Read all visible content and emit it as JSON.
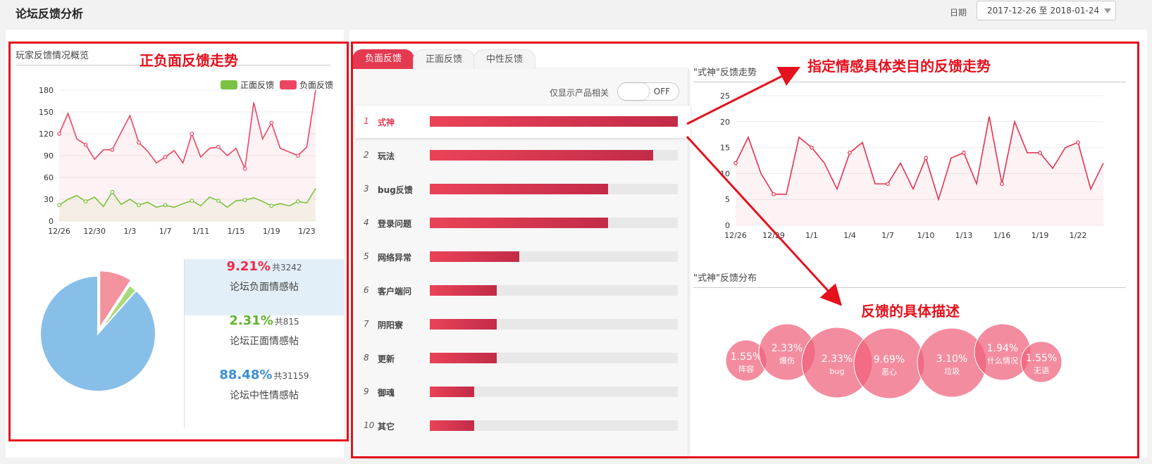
{
  "page": {
    "title": "论坛反馈分析",
    "date_label": "日期",
    "date_range": "2017-12-26 至 2018-01-24"
  },
  "annotations": {
    "left_box": "正负面反馈走势",
    "trend": "指定情感具体类目的反馈走势",
    "bubbles": "反馈的具体描述"
  },
  "overview": {
    "title": "玩家反馈情况概览",
    "legend": [
      {
        "name": "正面反馈",
        "color": "#7bc142"
      },
      {
        "name": "负面反馈",
        "color": "#ec4562"
      }
    ],
    "stats": [
      {
        "pct": "9.21%",
        "total": "共3242",
        "label": "论坛负面情感帖",
        "color": "#ec2a46"
      },
      {
        "pct": "2.31%",
        "total": "共815",
        "label": "论坛正面情感帖",
        "color": "#62b331"
      },
      {
        "pct": "88.48%",
        "total": "共31159",
        "label": "论坛中性情感帖",
        "color": "#3c8fd3"
      }
    ]
  },
  "tabs": [
    {
      "label": "负面反馈",
      "active": true
    },
    {
      "label": "正面反馈",
      "active": false
    },
    {
      "label": "中性反馈",
      "active": false
    }
  ],
  "filter": {
    "label": "仅显示产品相关",
    "toggle": "OFF"
  },
  "categories": [
    {
      "rank": "1",
      "name": "式神",
      "value": 100,
      "selected": true
    },
    {
      "rank": "2",
      "name": "玩法",
      "value": 90
    },
    {
      "rank": "3",
      "name": "bug反馈",
      "value": 72
    },
    {
      "rank": "4",
      "name": "登录问题",
      "value": 72
    },
    {
      "rank": "5",
      "name": "网络异常",
      "value": 36
    },
    {
      "rank": "6",
      "name": "客户端问",
      "value": 27
    },
    {
      "rank": "7",
      "name": "阴阳寮",
      "value": 27
    },
    {
      "rank": "8",
      "name": "更新",
      "value": 27
    },
    {
      "rank": "9",
      "name": "御魂",
      "value": 18
    },
    {
      "rank": "10",
      "name": "其它",
      "value": 18
    }
  ],
  "trend_title": "\"式神\"反馈走势",
  "dist_title": "\"式神\"反馈分布",
  "chart_data": [
    {
      "type": "line",
      "x": [
        "12/26",
        "12/27",
        "12/28",
        "12/29",
        "12/30",
        "12/31",
        "1/1",
        "1/2",
        "1/3",
        "1/4",
        "1/5",
        "1/6",
        "1/7",
        "1/8",
        "1/9",
        "1/10",
        "1/11",
        "1/12",
        "1/13",
        "1/14",
        "1/15",
        "1/16",
        "1/17",
        "1/18",
        "1/19",
        "1/20",
        "1/21",
        "1/22",
        "1/23",
        "1/24"
      ],
      "xticks": [
        "12/26",
        "12/30",
        "1/3",
        "1/7",
        "1/11",
        "1/15",
        "1/19",
        "1/23"
      ],
      "ylim": [
        0,
        180
      ],
      "yticks": [
        0,
        30,
        60,
        90,
        120,
        150,
        180
      ],
      "series": [
        {
          "name": "负面反馈",
          "color": "#ec4562",
          "values": [
            120,
            148,
            113,
            105,
            85,
            98,
            98,
            122,
            145,
            108,
            96,
            80,
            88,
            97,
            80,
            120,
            88,
            100,
            102,
            90,
            100,
            72,
            163,
            113,
            135,
            100,
            95,
            90,
            102,
            180
          ]
        },
        {
          "name": "正面反馈",
          "color": "#7bc142",
          "values": [
            22,
            30,
            35,
            27,
            33,
            20,
            40,
            23,
            30,
            22,
            26,
            19,
            22,
            19,
            24,
            28,
            21,
            33,
            28,
            19,
            28,
            29,
            32,
            27,
            21,
            24,
            21,
            27,
            25,
            45
          ]
        }
      ]
    },
    {
      "type": "pie",
      "slices": [
        {
          "label": "论坛负面情感帖",
          "value": 9.21,
          "color": "#f4929d"
        },
        {
          "label": "论坛正面情感帖",
          "value": 2.31,
          "color": "#a8da7a"
        },
        {
          "label": "论坛中性情感帖",
          "value": 88.48,
          "color": "#87bfe9"
        }
      ]
    },
    {
      "type": "line",
      "x": [
        "12/26",
        "12/27",
        "12/28",
        "12/29",
        "12/30",
        "12/31",
        "1/1",
        "1/2",
        "1/3",
        "1/4",
        "1/5",
        "1/6",
        "1/7",
        "1/8",
        "1/9",
        "1/10",
        "1/11",
        "1/12",
        "1/13",
        "1/14",
        "1/15",
        "1/16",
        "1/17",
        "1/18",
        "1/19",
        "1/20",
        "1/21",
        "1/22",
        "1/23",
        "1/24"
      ],
      "xticks": [
        "12/26",
        "12/29",
        "1/1",
        "1/4",
        "1/7",
        "1/10",
        "1/13",
        "1/16",
        "1/19",
        "1/22"
      ],
      "ylim": [
        0,
        25
      ],
      "yticks": [
        0,
        5,
        10,
        15,
        20,
        25
      ],
      "series": [
        {
          "name": "式神",
          "color": "#e4334f",
          "values": [
            12,
            17,
            10,
            6,
            6,
            17,
            15,
            12,
            7,
            14,
            16,
            8,
            8,
            12,
            7,
            13,
            5,
            13,
            14,
            8,
            21,
            8,
            20,
            14,
            14,
            11,
            15,
            16,
            7,
            12
          ]
        }
      ]
    },
    {
      "type": "bubble",
      "bubbles": [
        {
          "pct": "1.55%",
          "label": "阵容",
          "value": 1.55
        },
        {
          "pct": "2.33%",
          "label": "爆伤",
          "value": 2.33
        },
        {
          "pct": "2.33%",
          "label": "bug",
          "value": 2.33
        },
        {
          "pct": "9.69%",
          "label": "恶心",
          "value": 9.69
        },
        {
          "pct": "3.10%",
          "label": "垃圾",
          "value": 3.1
        },
        {
          "pct": "1.94%",
          "label": "什么情况",
          "value": 1.94
        },
        {
          "pct": "1.55%",
          "label": "无语",
          "value": 1.55
        }
      ]
    }
  ]
}
